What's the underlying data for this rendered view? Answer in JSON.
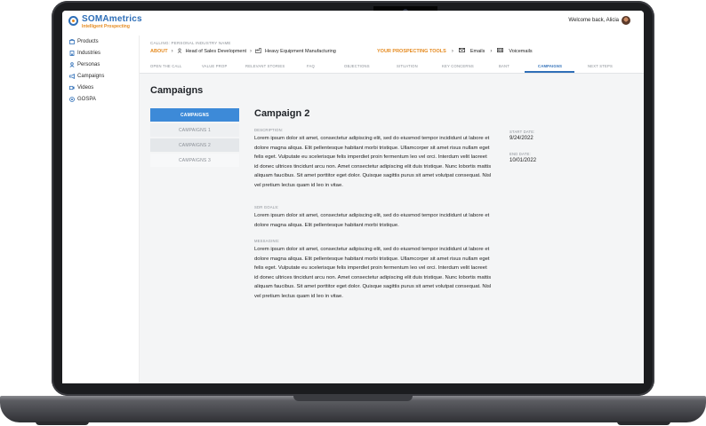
{
  "app": {
    "logo_title": "SOMAmetrics",
    "logo_subtitle": "Intelligent Prospecting",
    "welcome": "Welcome back, Alicia",
    "brand_color": "#2f6fb8",
    "accent_color": "#e58a1f"
  },
  "sidebar": {
    "items": [
      {
        "icon": "box-icon",
        "label": "Products"
      },
      {
        "icon": "building-icon",
        "label": "Industries"
      },
      {
        "icon": "user-icon",
        "label": "Personas"
      },
      {
        "icon": "megaphone-icon",
        "label": "Campaigns"
      },
      {
        "icon": "video-icon",
        "label": "Videos"
      },
      {
        "icon": "target-icon",
        "label": "GOSPA"
      }
    ]
  },
  "header": {
    "calling_label": "CALLING: PERSONAL INDUSTRY NAME",
    "breadcrumb": {
      "about": "ABOUT",
      "persona": "Head of Sales Development",
      "industry": "Heavy Equipment Manufacturing"
    },
    "tools": {
      "label": "YOUR PROSPECTING TOOLS",
      "emails": "Emails",
      "voicemails": "Voicemails"
    }
  },
  "tabs": [
    "OPEN THE CALL",
    "VALUE PROP",
    "RELEVANT STORIES",
    "FAQ",
    "OBJECTIONS",
    "SITUATION",
    "KEY CONCERNS",
    "BANT",
    "CAMPAIGNS",
    "NEXT STEPS"
  ],
  "active_tab": "CAMPAIGNS",
  "page_title": "Campaigns",
  "campaigns": [
    "CAMPAIGNS",
    "CAMPAIGNS 1",
    "CAMPAIGNS 2",
    "CAMPAIGNS 3"
  ],
  "detail": {
    "title": "Campaign 2",
    "description_label": "DESCRIPTION:",
    "description": "Lorem ipsum dolor sit amet, consectetur adipiscing elit, sed do eiusmod tempor incididunt ut labore et dolore magna aliqua. Elit pellentesque habitant morbi tristique. Ullamcorper sit amet risus nullam eget felis eget. Vulputate eu scelerisque felis imperdiet proin fermentum leo vel orci. Interdum velit laoreet id donec ultrices tincidunt arcu non. Amet consectetur adipiscing elit duis tristique. Nunc lobortis mattis aliquam faucibus. Sit amet porttitor eget dolor. Quisque sagittis purus sit amet volutpat consequat. Nisl vel pretium lectus quam id leo in vitae.",
    "sdr_label": "SDR GOALS:",
    "sdr_goals": "Lorem ipsum dolor sit amet, consectetur adipiscing elit, sed do eiusmod tempor incididunt ut labore et dolore magna aliqua. Elit pellentesque habitant morbi tristique.",
    "messaging_label": "MESSAGING:",
    "messaging": "Lorem ipsum dolor sit amet, consectetur adipiscing elit, sed do eiusmod tempor incididunt ut labore et dolore magna aliqua. Elit pellentesque habitant morbi tristique. Ullamcorper sit amet risus nullam eget felis eget. Vulputate eu scelerisque felis imperdiet proin fermentum leo vel orci. Interdum velit laoreet id donec ultrices tincidunt arcu non. Amet consectetur adipiscing elit duis tristique. Nunc lobortis mattis aliquam faucibus. Sit amet porttitor eget dolor. Quisque sagittis purus sit amet volutpat consequat. Nisl vel pretium lectus quam id leo in vitae.",
    "start_label": "START DATE:",
    "start_date": "9/24/2022",
    "end_label": "END DATE:",
    "end_date": "10/01/2022"
  }
}
